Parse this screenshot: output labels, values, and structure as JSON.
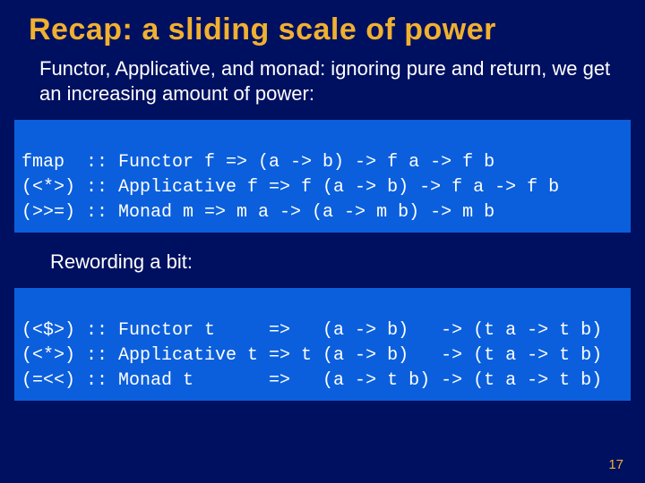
{
  "title": "Recap: a sliding scale of power",
  "intro": "Functor, Applicative, and monad: ignoring pure and return, we get an increasing amount of power:",
  "code1": {
    "l1": "fmap  :: Functor f => (a -> b) -> f a -> f b",
    "l2": "(<*>) :: Applicative f => f (a -> b) -> f a -> f b",
    "l3": "(>>=) :: Monad m => m a -> (a -> m b) -> m b"
  },
  "rewording": "Rewording a bit:",
  "code2": {
    "l1": "(<$>) :: Functor t     =>   (a -> b)   -> (t a -> t b)",
    "l2": "(<*>) :: Applicative t => t (a -> b)   -> (t a -> t b)",
    "l3": "(=<<) :: Monad t       =>   (a -> t b) -> (t a -> t b)"
  },
  "page_number": "17"
}
